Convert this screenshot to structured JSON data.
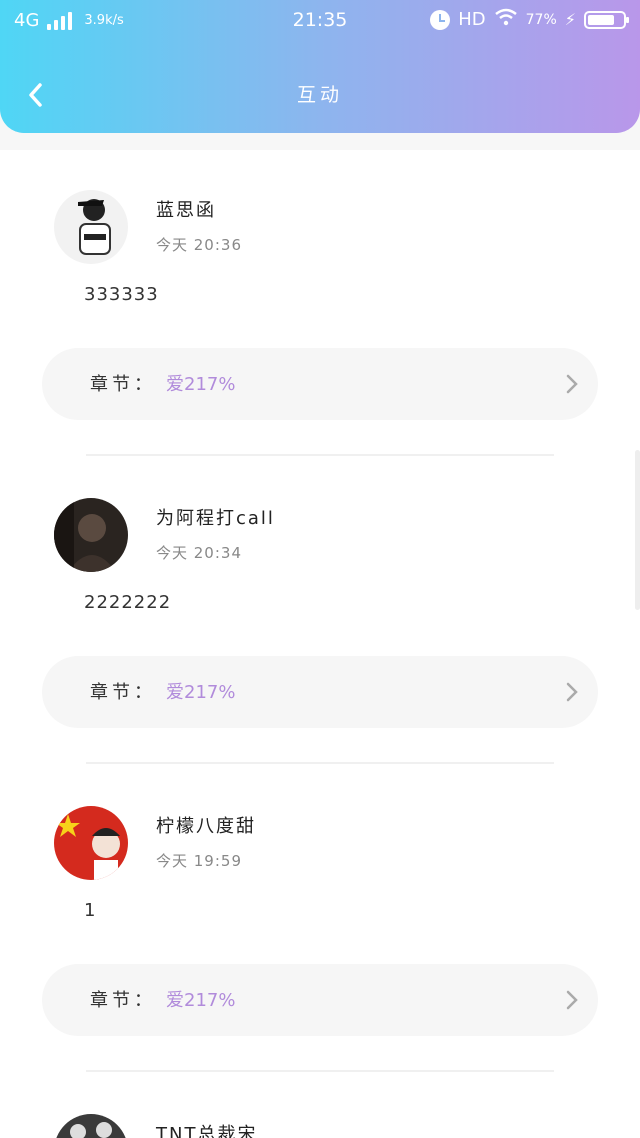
{
  "status_bar": {
    "carrier": "4G",
    "speed": "3.9k/s",
    "time": "21:35",
    "hd": "HD",
    "battery": "77%",
    "battery_level": 0.77
  },
  "header": {
    "title": "互动"
  },
  "colors": {
    "header_gradient": [
      "#4fd6f5",
      "#b997ea"
    ],
    "chapter_accent": "#b18bdb"
  },
  "comments": [
    {
      "user": "蓝思函",
      "time": "今天 20:36",
      "text": "333333",
      "chapter_label": "章节：",
      "chapter": "爱217%"
    },
    {
      "user": "为阿程打call",
      "time": "今天 20:34",
      "text": "2222222",
      "chapter_label": "章节：",
      "chapter": "爱217%"
    },
    {
      "user": "柠檬八度甜",
      "time": "今天 19:59",
      "text": "1",
      "chapter_label": "章节：",
      "chapter": "爱217%"
    },
    {
      "user": "TNT总裁宋",
      "time": "",
      "text": "",
      "chapter_label": "",
      "chapter": ""
    }
  ],
  "icons": {
    "back": "chevron-left-icon",
    "chapter_arrow": "chevron-right-icon"
  }
}
